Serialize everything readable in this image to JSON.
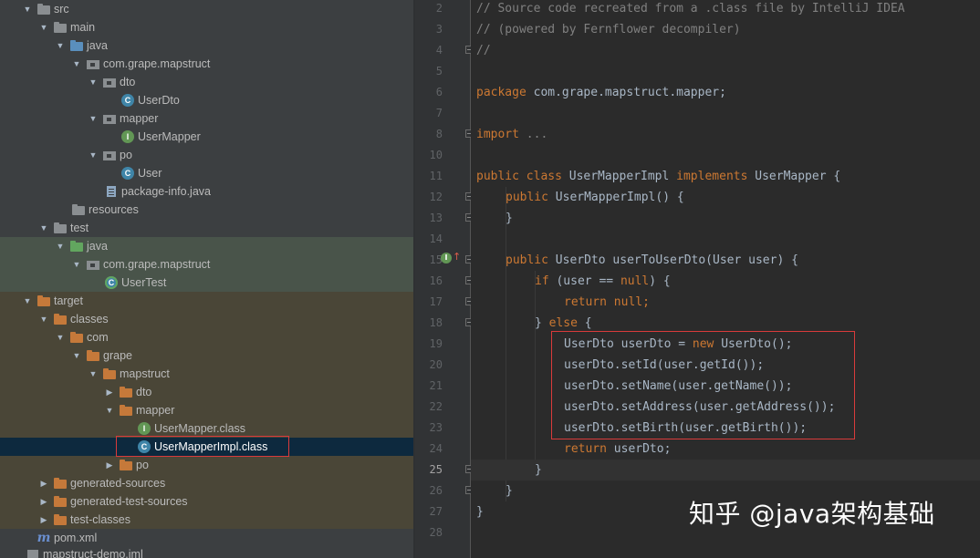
{
  "project_tree": {
    "items": [
      {
        "label": "src",
        "icon": "folder-icon"
      },
      {
        "label": "main",
        "icon": "folder-icon"
      },
      {
        "label": "java",
        "icon": "source-folder-icon"
      },
      {
        "label": "com.grape.mapstruct",
        "icon": "package-icon"
      },
      {
        "label": "dto",
        "icon": "package-icon"
      },
      {
        "label": "UserDto",
        "icon": "class-icon"
      },
      {
        "label": "mapper",
        "icon": "package-icon"
      },
      {
        "label": "UserMapper",
        "icon": "interface-icon"
      },
      {
        "label": "po",
        "icon": "package-icon"
      },
      {
        "label": "User",
        "icon": "class-icon"
      },
      {
        "label": "package-info.java",
        "icon": "package-info-icon"
      },
      {
        "label": "resources",
        "icon": "resources-folder-icon"
      },
      {
        "label": "test",
        "icon": "folder-icon"
      },
      {
        "label": "java",
        "icon": "test-source-folder-icon"
      },
      {
        "label": "com.grape.mapstruct",
        "icon": "package-icon"
      },
      {
        "label": "UserTest",
        "icon": "test-class-icon"
      },
      {
        "label": "target",
        "icon": "excluded-folder-icon"
      },
      {
        "label": "classes",
        "icon": "excluded-folder-icon"
      },
      {
        "label": "com",
        "icon": "excluded-folder-icon"
      },
      {
        "label": "grape",
        "icon": "excluded-folder-icon"
      },
      {
        "label": "mapstruct",
        "icon": "excluded-folder-icon"
      },
      {
        "label": "dto",
        "icon": "excluded-folder-icon"
      },
      {
        "label": "mapper",
        "icon": "excluded-folder-icon"
      },
      {
        "label": "UserMapper.class",
        "icon": "interface-icon"
      },
      {
        "label": "UserMapperImpl.class",
        "icon": "class-icon"
      },
      {
        "label": "po",
        "icon": "excluded-folder-icon"
      },
      {
        "label": "generated-sources",
        "icon": "excluded-folder-icon"
      },
      {
        "label": "generated-test-sources",
        "icon": "excluded-folder-icon"
      },
      {
        "label": "test-classes",
        "icon": "excluded-folder-icon"
      },
      {
        "label": "pom.xml",
        "icon": "maven-icon"
      },
      {
        "label": "mapstruct-demo.iml",
        "icon": "module-file-icon"
      }
    ],
    "selected": "UserMapperImpl.class"
  },
  "editor": {
    "line_numbers": [
      "2",
      "3",
      "4",
      "5",
      "6",
      "7",
      "8",
      "10",
      "11",
      "12",
      "13",
      "14",
      "15",
      "16",
      "17",
      "18",
      "19",
      "20",
      "21",
      "22",
      "23",
      "24",
      "25",
      "26",
      "27",
      "28"
    ],
    "current_line": "25",
    "lines": {
      "l2": "// Source code recreated from a .class file by IntelliJ IDEA",
      "l3": "// (powered by Fernflower decompiler)",
      "l4": "//",
      "l6_kw": "package",
      "l6_rest": " com.grape.mapstruct.mapper;",
      "l8_kw": "import",
      "l8_rest": " ...",
      "l11_a": "public class",
      "l11_b": " UserMapperImpl ",
      "l11_c": "implements",
      "l11_d": " UserMapper {",
      "l12_a": "public",
      "l12_b": " UserMapperImpl() {",
      "l13": "}",
      "l15_a": "public",
      "l15_b": " UserDto ",
      "l15_c": "userToUserDto",
      "l15_d": "(User user) {",
      "l16_a": "if",
      "l16_b": " (user == ",
      "l16_c": "null",
      "l16_d": ") {",
      "l17_a": "return null",
      "l17_b": ";",
      "l18_a": "} ",
      "l18_b": "else",
      "l18_c": " {",
      "l19_a": "UserDto userDto = ",
      "l19_b": "new",
      "l19_c": " UserDto();",
      "l20": "userDto.setId(user.getId());",
      "l21": "userDto.setName(user.getName());",
      "l22": "userDto.setAddress(user.getAddress());",
      "l23": "userDto.setBirth(user.getBirth());",
      "l24_a": "return",
      "l24_b": " userDto;",
      "l25": "}",
      "l26": "}",
      "l27": "}"
    }
  },
  "watermark": "知乎 @java架构基础",
  "colors": {
    "keyword": "#cc7832",
    "comment": "#808080",
    "method": "#ffc66d",
    "highlight_box": "#d93b3b",
    "selection": "#0d293e"
  }
}
